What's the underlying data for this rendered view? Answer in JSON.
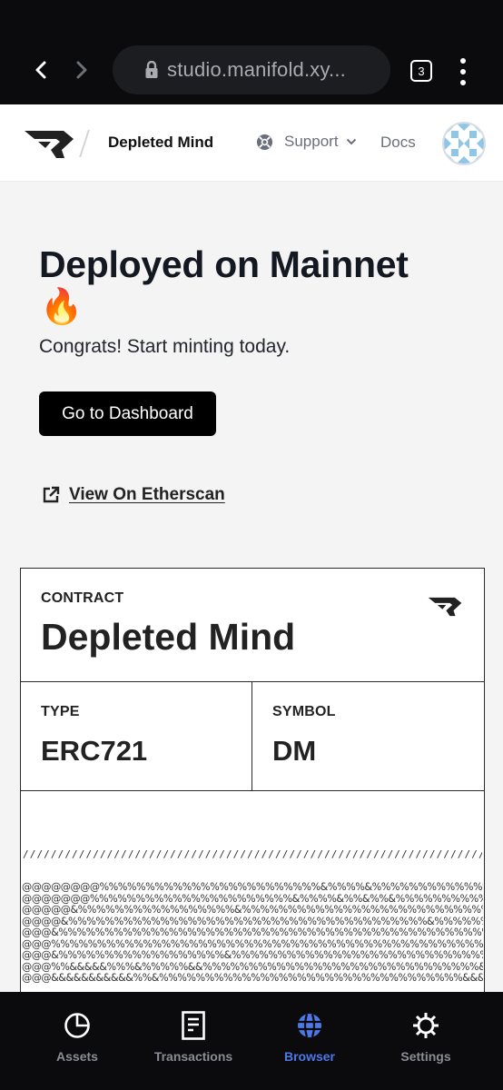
{
  "browser": {
    "url": "studio.manifold.xy...",
    "tab_count": "3",
    "icons": {
      "back": "chevron-left-icon",
      "forward": "chevron-right-icon",
      "lock": "lock-icon",
      "menu": "more-vertical-icon"
    }
  },
  "header": {
    "project_name": "Depleted Mind",
    "support_label": "Support",
    "docs_label": "Docs",
    "icons": {
      "logo": "manifold-logo",
      "support": "lifebuoy-icon",
      "chevron": "chevron-down-icon",
      "avatar": "user-avatar"
    }
  },
  "main": {
    "title": "Deployed on Mainnet",
    "emoji": "🔥",
    "subtitle": "Congrats! Start minting today.",
    "dashboard_button": "Go to Dashboard",
    "etherscan_link": "View On Etherscan"
  },
  "contract_card": {
    "contract_label": "CONTRACT",
    "contract_name": "Depleted Mind",
    "type_label": "TYPE",
    "type_value": "ERC721",
    "symbol_label": "SYMBOL",
    "symbol_value": "DM",
    "divider": "////////////////////////////////////////////////////////////////////////////",
    "ascii_rows": [
      "@@@@@@@@%%%%%%%%%%%%%%%%%%%%%%%%&%%%%&%%%%%%%%%%%%%%%%%%%%%@@@@@@@@@@",
      "@@@@@@@%%%%%%%%%%%%%%%%%%%%%%&%%%%&%%&%%&%%%%%%%%%%%%%%%%%%%@@@@@@@@@",
      "@@@@@&%%%%%%%%%%%%%%%%%&%%%%%%%%%%%%%%%%%%%%%%%%%%%%%%%%%%%%%@@@@@@@@",
      "@@@@&%%%%%%%%%%%%%%%%%%%%%%%%%%%%%%%%%%%%%%%&%%%%%%%%&@@@@@@@",
      "@@@&%%%%%%%%%%%%%%%%%%%%%%%%%%%%%%%%%%%%%%%%%%%%%%%%%%%%%%&&@@@@@",
      "@@@%%%%%%%%%%%%%%%%%%%%%%%%%%%%%%%%%%%%%%%%%%%%%%%%%&%%&%&@@@@@",
      "@@@&%%%%%%%%%%%%%%%%%%&%%%%%%%%%%%%%%%%%%%%%%%%%%%%&&&&&&&@@@@@",
      "@@@%%&&&&&%%%&%%%%%&&%%%%%%%%%%%%%%%%%%%%%%%%%%%%%%&&&&&&&&&@@@@@",
      "@@@&&&&&&&&&&&%%&%%%%%%%%%%%%%%%%%%%%%%%%%%%%%%%%%&&&&@&&&&@@@@@"
    ],
    "icons": {
      "logo": "manifold-logo"
    }
  },
  "bottom_nav": {
    "active": "Browser",
    "active_color": "#4d78e6",
    "items": [
      {
        "label": "Assets",
        "icon": "pie-chart-icon"
      },
      {
        "label": "Transactions",
        "icon": "document-icon"
      },
      {
        "label": "Browser",
        "icon": "globe-icon"
      },
      {
        "label": "Settings",
        "icon": "gear-icon"
      }
    ]
  }
}
